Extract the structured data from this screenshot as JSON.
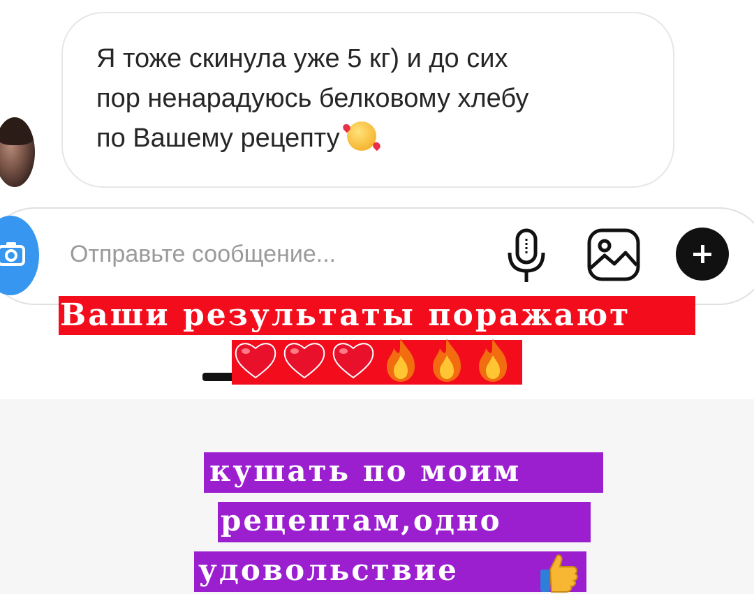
{
  "message": {
    "lines": [
      "Я тоже скинула уже 5 кг) и до сих",
      "пор ненарадуюсь белковому хлебу",
      "по Вашему рецепту"
    ],
    "emoji": "smiling-face-with-hearts-icon"
  },
  "composer": {
    "placeholder": "Отправьте сообщение..."
  },
  "overlay": {
    "red_caption": "Ваши результаты поражают",
    "emoji_row": [
      "heart",
      "heart",
      "heart",
      "fire",
      "fire",
      "fire"
    ],
    "purple_lines": [
      "кушать по моим",
      "рецептам,одно",
      "удовольствие"
    ],
    "thumb_emoji": "thumbs-up-icon"
  },
  "colors": {
    "red_band": "#f20c1c",
    "purple_band": "#9b1fcf",
    "accent_blue": "#3797f0"
  }
}
